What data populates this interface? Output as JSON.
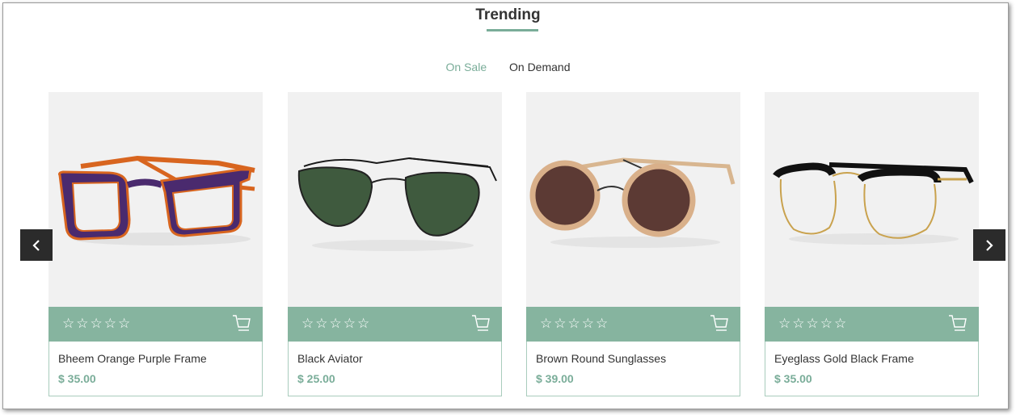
{
  "section": {
    "title": "Trending"
  },
  "tabs": [
    {
      "label": "On Sale",
      "active": true
    },
    {
      "label": "On Demand",
      "active": false
    }
  ],
  "colors": {
    "accent": "#7aad99",
    "bar": "#86b49f",
    "image_bg": "#f1f1f1",
    "arrow_bg": "#2b2b2b"
  },
  "products": [
    {
      "name": "Bheem Orange Purple Frame",
      "price": "$ 35.00",
      "rating": "☆☆☆☆☆",
      "image_icon": "orange-purple-glasses-icon"
    },
    {
      "name": "Black Aviator",
      "price": "$ 25.00",
      "rating": "☆☆☆☆☆",
      "image_icon": "black-aviator-sunglasses-icon"
    },
    {
      "name": "Brown Round Sunglasses",
      "price": "$ 39.00",
      "rating": "☆☆☆☆☆",
      "image_icon": "brown-round-sunglasses-icon"
    },
    {
      "name": "Eyeglass Gold Black Frame",
      "price": "$ 35.00",
      "rating": "☆☆☆☆☆",
      "image_icon": "gold-black-eyeglasses-icon"
    }
  ],
  "icons": {
    "cart": "cart-icon",
    "prev": "chevron-left-icon",
    "next": "chevron-right-icon"
  }
}
